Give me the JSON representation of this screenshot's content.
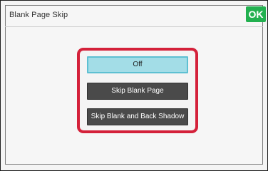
{
  "header": {
    "title": "Blank Page Skip",
    "ok_label": "OK"
  },
  "options": [
    {
      "label": "Off",
      "selected": true
    },
    {
      "label": "Skip Blank Page",
      "selected": false
    },
    {
      "label": "Skip Blank and Back Shadow",
      "selected": false
    }
  ],
  "colors": {
    "ok_button": "#22b04f",
    "highlight_frame": "#d4213a",
    "selected_option": "#a3dde7",
    "option_dark": "#4a4a4a"
  }
}
